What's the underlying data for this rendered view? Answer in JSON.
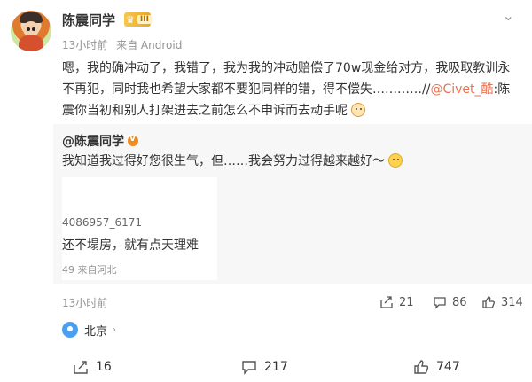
{
  "post": {
    "author": "陈震同学",
    "badge_level": "III",
    "time": "13小时前",
    "source": "来自 Android",
    "content_before": "嗯，我的确冲动了，我错了，我为我的冲动赔偿了70w现金给对方，我吸取教训永不再犯，同时我也希望大家都不要犯同样的错，得不偿失…………//",
    "mention": "@Civet_酷",
    "content_after": ":陈震你当初和别人打架进去之前怎么不申诉而去动手呢"
  },
  "retweet": {
    "author": "@陈震同学",
    "text": "我知道我过得好您很生气，但……我会努力过得越来越好～",
    "thumb_line1": "4086957_6171",
    "thumb_line2": "还不塌房，就有点天理难",
    "thumb_line3": "49  来自河北",
    "time": "13小时前",
    "share_count": "21",
    "comment_count": "86",
    "like_count": "314"
  },
  "location": {
    "label": "北京",
    "chevron": "›"
  },
  "toolbar": {
    "share_count": "16",
    "comment_count": "217",
    "like_count": "747"
  },
  "icons": {
    "more": "chevron-down-icon",
    "share": "share-icon",
    "comment": "comment-icon",
    "like": "thumbs-up-icon",
    "location": "location-pin-icon"
  }
}
